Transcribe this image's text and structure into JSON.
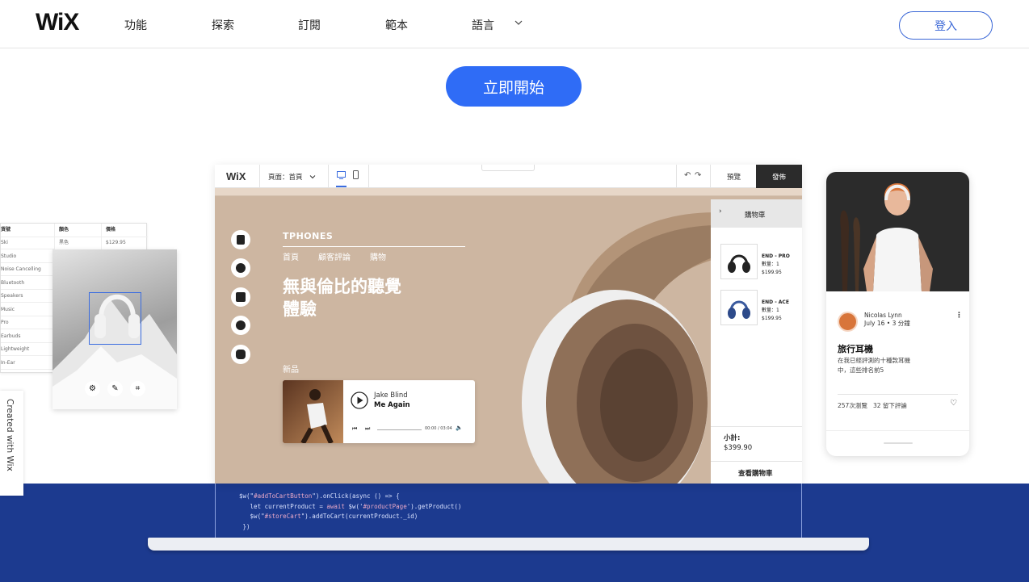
{
  "nav": {
    "logo": "WiX",
    "items": [
      "功能",
      "探索",
      "訂閱",
      "範本",
      "語言"
    ],
    "login": "登入"
  },
  "hero": {
    "cta": "立即開始"
  },
  "created_badge": "Created with Wix",
  "left_table": {
    "headers": [
      "貨號",
      "顏色",
      "價格"
    ],
    "row1": {
      "name": "Ski",
      "color": "黑色",
      "price": "$129.95"
    },
    "rows": [
      "Studio",
      "Noise Cancelling",
      "Bluetooth",
      "Speakers",
      "Music",
      "Pro",
      "Earbuds",
      "Lightweight",
      "In-Ear"
    ]
  },
  "editor": {
    "logo": "WiX",
    "page_select": "頁面：首頁",
    "preview": "預覽",
    "publish": "發佈",
    "site": {
      "brand": "TPHONES",
      "menu": [
        "首頁",
        "顧客評論",
        "購物"
      ],
      "headline_line1": "無與倫比的聽覺",
      "headline_line2": "體驗",
      "new_label": "新品"
    },
    "player": {
      "artist": "Jake Blind",
      "track": "Me Again",
      "time": "00:00 / 03:04"
    },
    "cart": {
      "title": "購物車",
      "items": [
        {
          "name": "END - PRO",
          "qty": "數量：1",
          "price": "$199.95"
        },
        {
          "name": "END - ACE",
          "qty": "數量：1",
          "price": "$199.95"
        }
      ],
      "subtotal_label": "小計:",
      "subtotal": "$399.90",
      "view_cart": "查看購物車"
    }
  },
  "code": {
    "line1_a": "$w(\"",
    "line1_b": "#addToCartButton",
    "line1_c": "\").onClick(async () => {",
    "line2_a": "   let currentProduct = ",
    "line2_b": "await",
    "line2_c": " $w('",
    "line2_d": "#productPage",
    "line2_e": "').getProduct()",
    "line3_a": "   $w(\"",
    "line3_b": "#storeCart",
    "line3_c": "\").addToCart(currentProduct._id)",
    "line4": " })"
  },
  "phone": {
    "author": "Nicolas Lynn",
    "meta": "July 16 • 3 分鐘",
    "title": "旅行耳機",
    "body_line1": "在我已經評測的十種款耳機",
    "body_line2": "中，這些排名前5",
    "stats": "257次瀏覽   32 留下評論"
  },
  "colors": {
    "accent": "#2f6cf6",
    "band": "#1c3a8f",
    "beige": "#cdb6a1"
  }
}
